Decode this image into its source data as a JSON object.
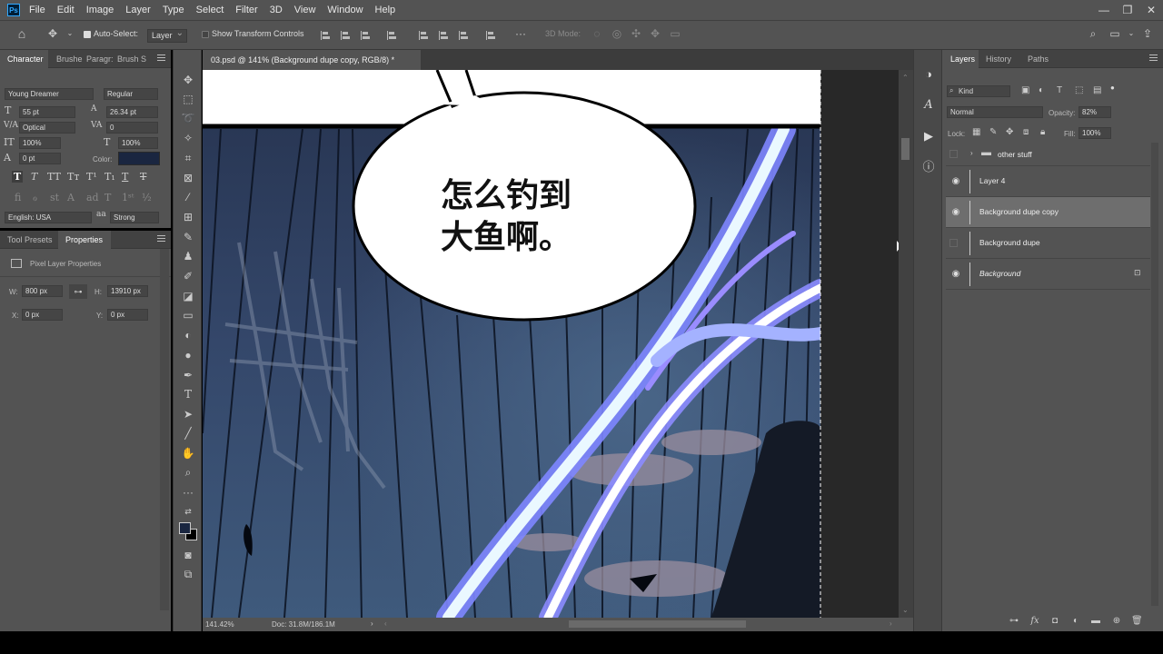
{
  "app": {
    "logo": "Ps"
  },
  "menu": [
    "File",
    "Edit",
    "Image",
    "Layer",
    "Type",
    "Select",
    "Filter",
    "3D",
    "View",
    "Window",
    "Help"
  ],
  "options_bar": {
    "auto_select_label": "Auto-Select:",
    "auto_select_target": "Layer",
    "transform_label": "Show Transform Controls",
    "mode_3d_label": "3D Mode:"
  },
  "character_panel": {
    "tabs": [
      "Character",
      "Brushe",
      "Paragr:",
      "Brush S"
    ],
    "font_family": "Young Dreamer",
    "font_style": "Regular",
    "font_size": "55 pt",
    "leading": "26.34 pt",
    "kerning": "Optical",
    "tracking": "0",
    "vertical_scale": "100%",
    "horizontal_scale": "100%",
    "baseline_shift": "0 pt",
    "color_label": "Color:",
    "color_value": "#1a2640",
    "language": "English: USA",
    "antialias": "Strong"
  },
  "properties_panel": {
    "tabs": [
      "Tool Presets",
      "Properties"
    ],
    "section_title": "Pixel Layer Properties",
    "w_label": "W:",
    "w_value": "800 px",
    "h_label": "H:",
    "h_value": "13910 px",
    "x_label": "X:",
    "x_value": "0 px",
    "y_label": "Y:",
    "y_value": "0 px"
  },
  "document": {
    "tab_title": "03.psd @ 141% (Background dupe copy, RGB/8) *",
    "speech_text_line1": "怎么钓到",
    "speech_text_line2": "大鱼啊。",
    "zoom": "141.42%",
    "doc_info": "Doc: 31.8M/186.1M"
  },
  "layers_panel": {
    "tabs": [
      "Layers",
      "History",
      "Paths"
    ],
    "filter_kind": "Kind",
    "blend_mode": "Normal",
    "opacity_label": "Opacity:",
    "opacity_value": "82%",
    "lock_label": "Lock:",
    "fill_label": "Fill:",
    "fill_value": "100%",
    "layers": [
      {
        "name": "other stuff",
        "type": "group",
        "visible": false
      },
      {
        "name": "Layer 4",
        "visible": true
      },
      {
        "name": "Background dupe copy",
        "visible": true,
        "selected": true
      },
      {
        "name": "Background dupe",
        "visible": false
      },
      {
        "name": "Background",
        "visible": true,
        "locked": true
      }
    ]
  },
  "colors": {
    "ui_dark": "#535353",
    "foreground": "#1a2640",
    "background": "#000000",
    "lightning": "#8890ff"
  }
}
